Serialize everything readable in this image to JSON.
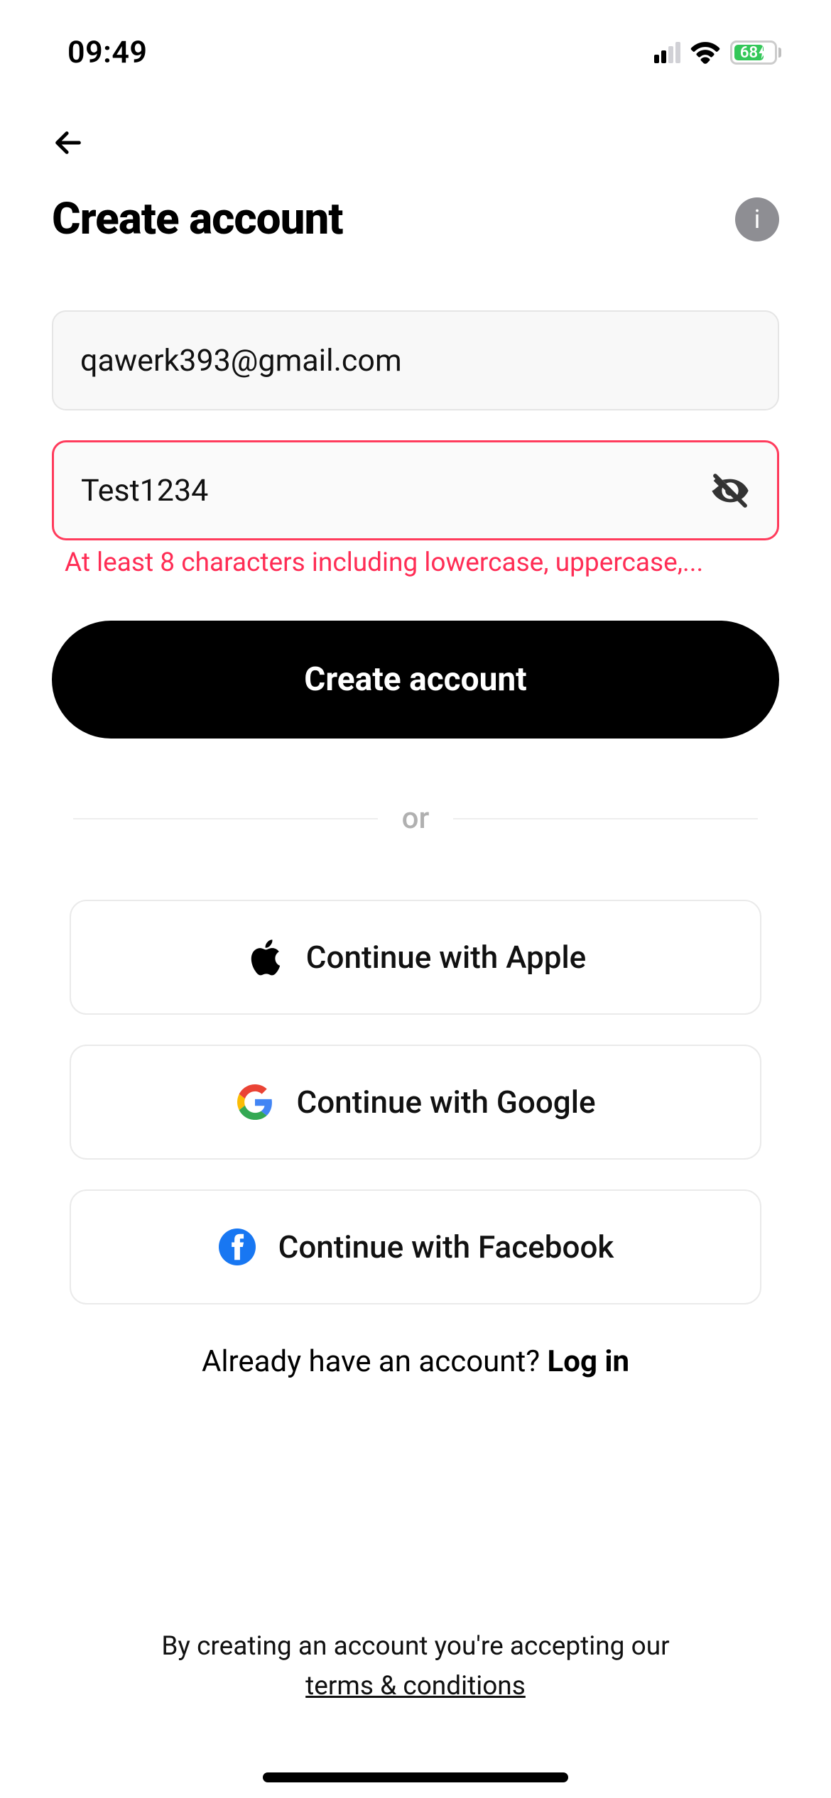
{
  "status": {
    "time": "09:49",
    "battery_percent": "68"
  },
  "nav": {
    "back_label": "Back"
  },
  "header": {
    "title": "Create account",
    "info_label": "i"
  },
  "form": {
    "email_value": "qawerk393@gmail.com",
    "password_value": "Test1234",
    "password_error": "At least 8 characters including lowercase, uppercase,...",
    "submit_label": "Create account"
  },
  "divider": {
    "label": "or"
  },
  "social": {
    "apple_label": "Continue with Apple",
    "google_label": "Continue with Google",
    "facebook_label": "Continue with Facebook"
  },
  "login": {
    "prompt": "Already have an account? ",
    "link": "Log in"
  },
  "footer": {
    "text": "By creating an account you're accepting our",
    "terms_label": "terms & conditions"
  }
}
